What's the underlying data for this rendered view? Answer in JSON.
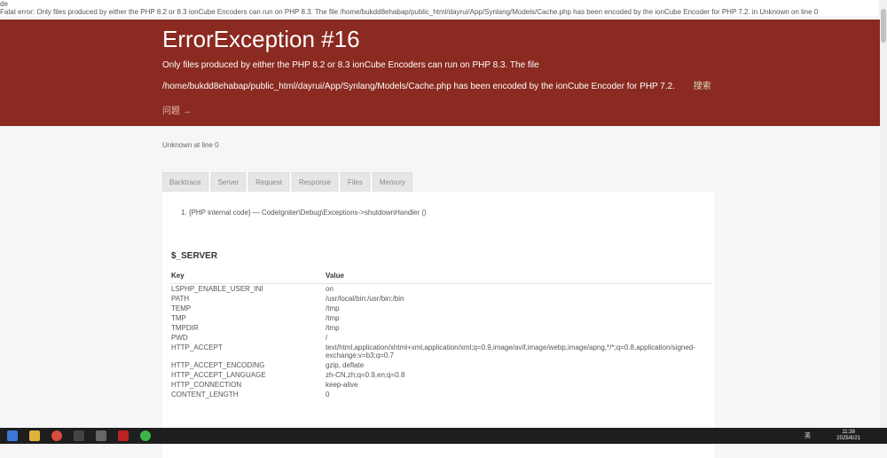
{
  "top": {
    "line1": "de",
    "line2": "Fatal error: Only files produced by either the PHP 8.2 or 8.3 ionCube Encoders can run on PHP 8.3. The file /home/bukdd8ehabap/public_html/dayrui/App/Synlang/Models/Cache.php has been encoded by the ionCube Encoder for PHP 7.2. in Unknown on line 0"
  },
  "header": {
    "title": "ErrorException #16",
    "message_line1": "Only files produced by either the PHP 8.2 or 8.3 ionCube Encoders can run on PHP 8.3. The file",
    "message_line2": "/home/bukdd8ehabap/public_html/dayrui/App/Synlang/Models/Cache.php has been encoded by the ionCube Encoder for PHP 7.2.",
    "search": "搜索",
    "question": "问题 →"
  },
  "location": "Unknown at line 0",
  "tabs": [
    "Backtrace",
    "Server",
    "Request",
    "Response",
    "Files",
    "Memory"
  ],
  "backtrace": "1. {PHP internal code}   —  CodeIgniter\\Debug\\Exceptions->shutdownHandler ()",
  "server": {
    "title": "$_SERVER",
    "key_header": "Key",
    "value_header": "Value",
    "rows": [
      {
        "k": "LSPHP_ENABLE_USER_INI",
        "v": "on"
      },
      {
        "k": "PATH",
        "v": "/usr/local/bin:/usr/bin:/bin"
      },
      {
        "k": "TEMP",
        "v": "/tmp"
      },
      {
        "k": "TMP",
        "v": "/tmp"
      },
      {
        "k": "TMPDIR",
        "v": "/tmp"
      },
      {
        "k": "PWD",
        "v": "/"
      },
      {
        "k": "HTTP_ACCEPT",
        "v": "text/html,application/xhtml+xml,application/xml;q=0.9,image/avif,image/webp,image/apng,*/*;q=0.8,application/signed-exchange;v=b3;q=0.7"
      },
      {
        "k": "HTTP_ACCEPT_ENCODING",
        "v": "gzip, deflate"
      },
      {
        "k": "HTTP_ACCEPT_LANGUAGE",
        "v": "zh-CN,zh;q=0.9,en;q=0.8"
      },
      {
        "k": "HTTP_CONNECTION",
        "v": "keep-alive"
      },
      {
        "k": "CONTENT_LENGTH",
        "v": "0"
      }
    ]
  },
  "taskbar": {
    "time": "11:38",
    "date": "2025/6/21",
    "ime": "英"
  }
}
